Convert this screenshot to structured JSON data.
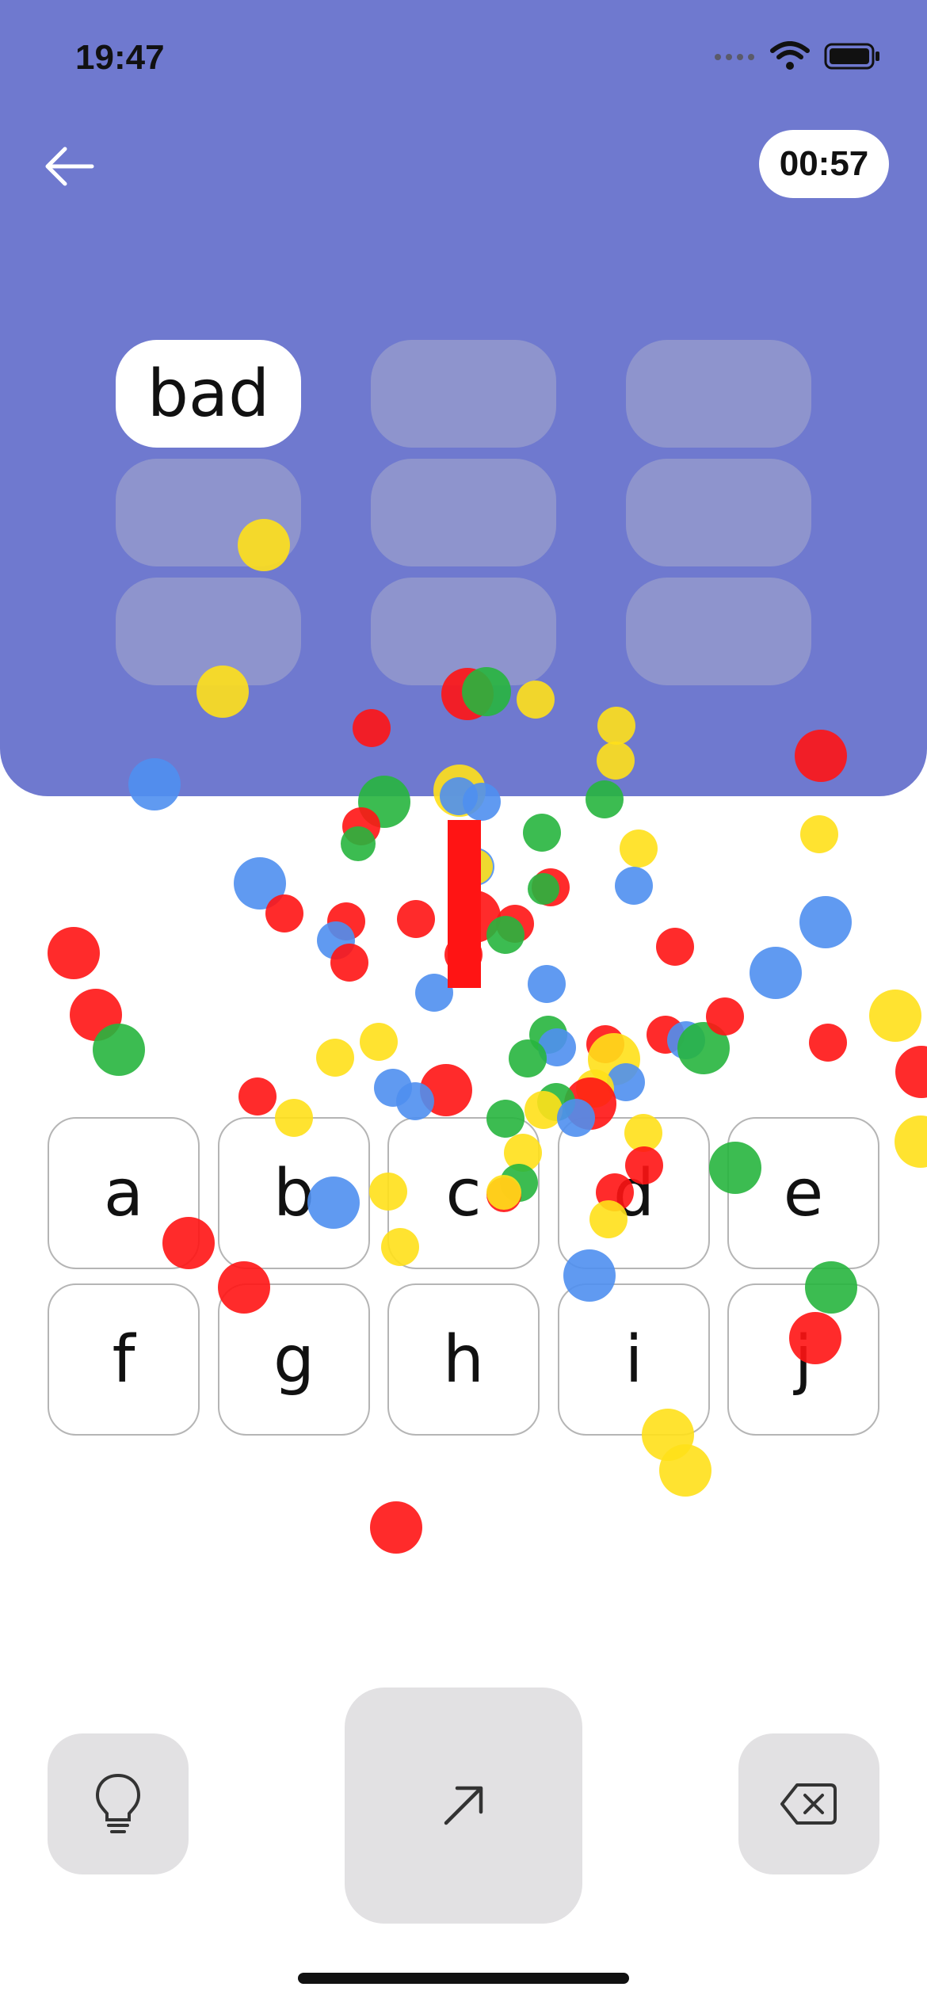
{
  "status_bar": {
    "time": "19:47"
  },
  "header": {
    "back_icon": "arrow-left-icon",
    "timer": "00:57",
    "background_color": "#6f79cf"
  },
  "word_slots": [
    {
      "word": "bad",
      "filled": true
    },
    {
      "word": "",
      "filled": false
    },
    {
      "word": "",
      "filled": false
    },
    {
      "word": "",
      "filled": false
    },
    {
      "word": "",
      "filled": false
    },
    {
      "word": "",
      "filled": false
    },
    {
      "word": "",
      "filled": false
    },
    {
      "word": "",
      "filled": false
    },
    {
      "word": "",
      "filled": false
    }
  ],
  "letters": [
    "a",
    "b",
    "c",
    "d",
    "e",
    "f",
    "g",
    "h",
    "i",
    "j"
  ],
  "actions": {
    "hint_icon": "lightbulb-icon",
    "submit_icon": "arrow-up-right-icon",
    "delete_icon": "backspace-icon"
  },
  "confetti_colors": {
    "red": "#ff1414",
    "yellow": "#ffe01a",
    "blue": "#4f8ff0",
    "green": "#27b53e"
  }
}
